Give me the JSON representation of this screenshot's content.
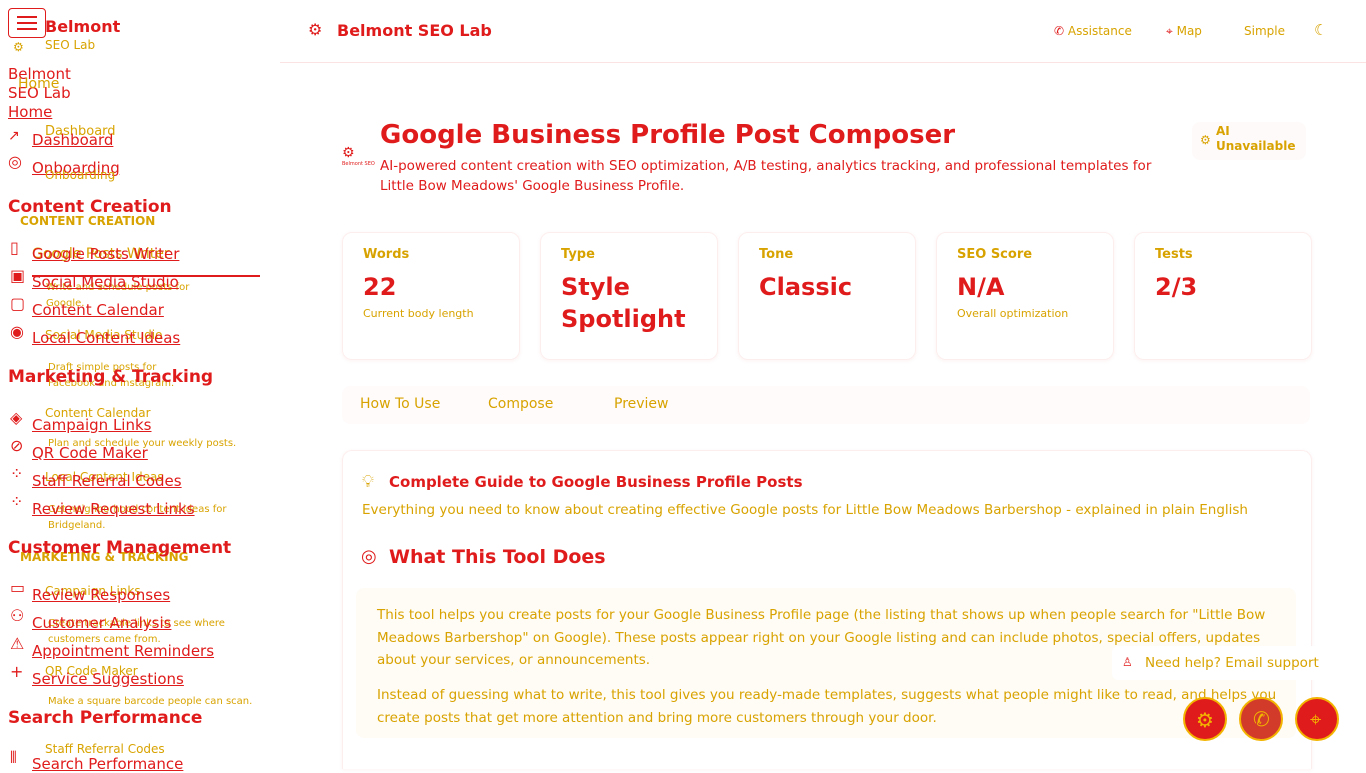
{
  "sidebar": {
    "brand_name": "Belmont",
    "brand_sub": "SEO Lab",
    "brand_title": "Belmont",
    "brand_title_sub": "SEO Lab",
    "home_link": "Home",
    "home_ghost": "Home",
    "dashboard_link": "Dashboard",
    "dashboard_ghost": "Dashboard",
    "onboarding_link": "Onboarding",
    "onboarding_ghost": "Onboarding",
    "section_content": "Content Creation",
    "section_content_ghost": "CONTENT CREATION",
    "google_posts_link": "Google Posts Writer",
    "google_posts_ghost": "Google Posts Writer",
    "google_posts_desc": "Write and schedule posts for Google.",
    "social_media_link": "Social Media Studio",
    "social_media_ghost": "Social Media Studio",
    "social_media_desc": "Draft simple posts for Facebook and Instagram.",
    "content_calendar_link": "Content Calendar",
    "content_calendar_ghost": "Content Calendar",
    "content_calendar_desc": "Plan and schedule your weekly posts.",
    "local_content_link": "Local Content Ideas",
    "local_content_ghost": "Local Content Ideas",
    "local_content_desc": "Get neighborhood content ideas for Bridgeland.",
    "section_marketing": "Marketing & Tracking",
    "section_marketing_ghost": "MARKETING & TRACKING",
    "campaign_links_link": "Campaign Links",
    "campaign_links_ghost": "Campaign Links",
    "campaign_links_desc": "Create trackable links to see where customers came from.",
    "qr_link": "QR Code Maker",
    "qr_ghost": "QR Code Maker",
    "qr_desc": "Make a square barcode people can scan.",
    "staff_referral_link": "Staff Referral Codes",
    "staff_referral_ghost": "Staff Referral Codes",
    "review_request_link": "Review Request Links",
    "section_customer": "Customer Management",
    "review_responses_link": "Review Responses",
    "customer_analysis_link": "Customer Analysis",
    "appointment_link": "Appointment Reminders",
    "service_suggestions_link": "Service Suggestions",
    "section_search": "Search Performance",
    "search_performance_link": "Search Performance"
  },
  "topbar": {
    "title": "Belmont SEO Lab",
    "assistance": "Assistance",
    "map": "Map",
    "simple": "Simple"
  },
  "page": {
    "title": "Google Business Profile Post Composer",
    "subtitle": "AI-powered content creation with SEO optimization, A/B testing, analytics tracking, and professional templates for Little Bow Meadows' Google Business Profile.",
    "ai_status": "AI Unavailable",
    "logo_text": "Belmont SEO"
  },
  "stats": [
    {
      "label": "Words",
      "value": "22",
      "sub": "Current body length"
    },
    {
      "label": "Type",
      "value": "Style Spotlight",
      "sub": ""
    },
    {
      "label": "Tone",
      "value": "Classic",
      "sub": ""
    },
    {
      "label": "SEO Score",
      "value": "N/A",
      "sub": "Overall optimization"
    },
    {
      "label": "Tests",
      "value": "2/3",
      "sub": ""
    }
  ],
  "tabs": [
    "How To Use",
    "Compose",
    "Preview"
  ],
  "guide": {
    "title": "Complete Guide to Google Business Profile Posts",
    "subtitle": "Everything you need to know about creating effective Google posts for Little Bow Meadows Barbershop - explained in plain English",
    "section_title": "What This Tool Does",
    "para1": "This tool helps you create posts for your Google Business Profile page (the listing that shows up when people search for \"Little Bow Meadows Barbershop\" on Google). These posts appear right on your Google listing and can include photos, special offers, updates about your services, or announcements.",
    "para2": "Instead of guessing what to write, this tool gives you ready-made templates, suggests what people might like to read, and helps you create posts that get more attention and bring more customers through your door."
  },
  "help": {
    "text": "Need help? Email support"
  },
  "colors": {
    "accent": "#e01b1b",
    "secondary": "#d8a300",
    "fab_border": "#f2b400"
  },
  "icons": [
    "menu-icon",
    "logo-icon",
    "trend-icon",
    "onboarding-icon",
    "document-icon",
    "image-icon",
    "calendar-icon",
    "location-icon",
    "tag-icon",
    "link-icon",
    "qr-icon",
    "chat-icon",
    "users-icon",
    "alert-icon",
    "plus-icon",
    "chart-icon",
    "phone-icon",
    "map-pin-icon",
    "moon-icon",
    "lightbulb-icon",
    "target-icon",
    "person-icon",
    "brain-icon"
  ]
}
